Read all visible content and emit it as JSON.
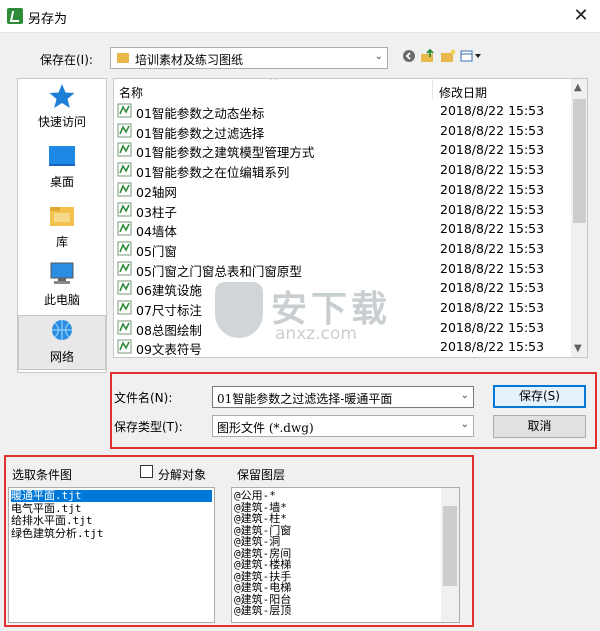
{
  "window": {
    "title": "另存为",
    "close_glyph": "✕"
  },
  "toolbar": {
    "save_in_label": "保存在(I):",
    "current_folder": "培训素材及练习图纸",
    "icons": [
      "back-icon",
      "up-folder-icon",
      "new-folder-icon",
      "view-menu-icon"
    ]
  },
  "places": [
    {
      "label": "快速访问",
      "icon": "star-icon"
    },
    {
      "label": "桌面",
      "icon": "desktop-icon"
    },
    {
      "label": "库",
      "icon": "library-icon"
    },
    {
      "label": "此电脑",
      "icon": "computer-icon"
    },
    {
      "label": "网络",
      "icon": "network-icon",
      "selected": true
    }
  ],
  "file_list": {
    "col_name": "名称",
    "col_date": "修改日期",
    "rows": [
      {
        "name": "01智能参数之动态坐标",
        "date": "2018/8/22 15:53"
      },
      {
        "name": "01智能参数之过滤选择",
        "date": "2018/8/22 15:53"
      },
      {
        "name": "01智能参数之建筑模型管理方式",
        "date": "2018/8/22 15:53"
      },
      {
        "name": "01智能参数之在位编辑系列",
        "date": "2018/8/22 15:53"
      },
      {
        "name": "02轴网",
        "date": "2018/8/22 15:53"
      },
      {
        "name": "03柱子",
        "date": "2018/8/22 15:53"
      },
      {
        "name": "04墙体",
        "date": "2018/8/22 15:53"
      },
      {
        "name": "05门窗",
        "date": "2018/8/22 15:53"
      },
      {
        "name": "05门窗之门窗总表和门窗原型",
        "date": "2018/8/22 15:53"
      },
      {
        "name": "06建筑设施",
        "date": "2018/8/22 15:53"
      },
      {
        "name": "07尺寸标注",
        "date": "2018/8/22 15:53"
      },
      {
        "name": "08总图绘制",
        "date": "2018/8/22 15:53"
      },
      {
        "name": "09文表符号",
        "date": "2018/8/22 15:53"
      }
    ]
  },
  "watermark": {
    "big": "安下载",
    "small": "anxz.com"
  },
  "save_form": {
    "filename_label": "文件名(N):",
    "filename_value": "01智能参数之过滤选择-暖通平面",
    "filetype_label": "保存类型(T):",
    "filetype_value": "图形文件 (*.dwg)",
    "save_button": "保存(S)",
    "cancel_button": "取消"
  },
  "filter_panel": {
    "condition_title": "选取条件图",
    "decompose_label": "分解对象",
    "decompose_checked": false,
    "keep_layers_title": "保留图层",
    "conditions": [
      "暖通平面.tjt",
      "电气平面.tjt",
      "给排水平面.tjt",
      "绿色建筑分析.tjt"
    ],
    "selected_condition_index": 0,
    "layers": [
      "@公用-*",
      "@建筑-墙*",
      "@建筑-柱*",
      "@建筑-门窗",
      "@建筑-洞",
      "@建筑-房间",
      "@建筑-楼梯",
      "@建筑-扶手",
      "@建筑-电梯",
      "@建筑-阳台",
      "@建筑-层顶"
    ]
  },
  "colors": {
    "highlight_red": "#e0312f",
    "selection_blue": "#0078d7"
  }
}
